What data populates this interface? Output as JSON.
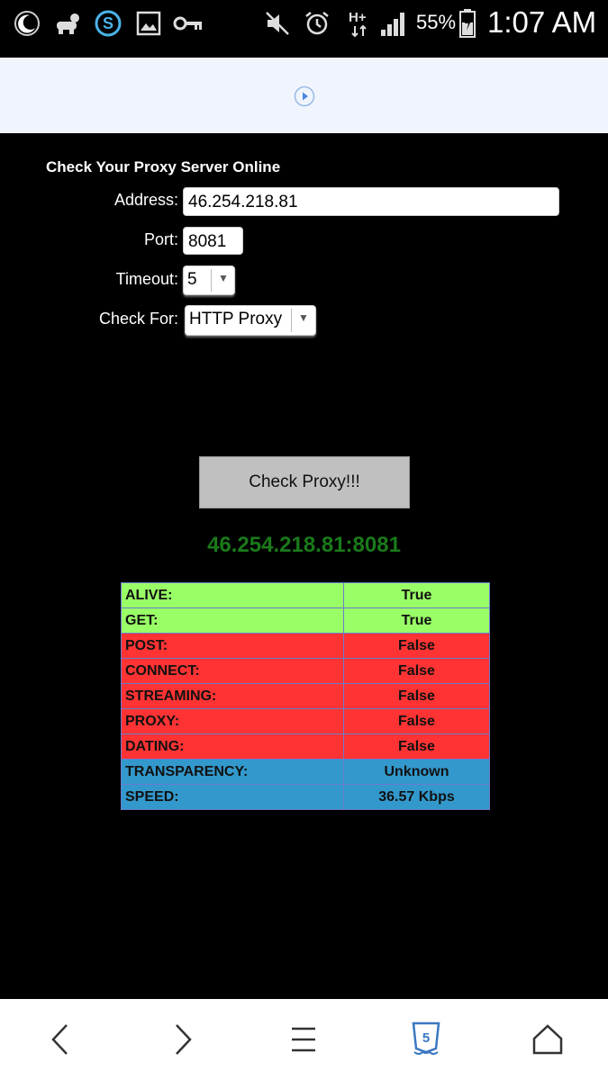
{
  "status_bar": {
    "icons": [
      "night-mode-icon",
      "baby-monitor-icon",
      "app-s-icon",
      "gallery-icon",
      "vpn-key-icon",
      "mute-icon",
      "alarm-icon",
      "hplus-data-icon",
      "signal-icon",
      "battery-icon"
    ],
    "battery_percent": "55%",
    "time": "1:07 AM"
  },
  "ad": {
    "icon": "ad-play-icon"
  },
  "form": {
    "heading": "Check Your Proxy Server Online",
    "address_label": "Address:",
    "address_value": "46.254.218.81",
    "port_label": "Port:",
    "port_value": "8081",
    "timeout_label": "Timeout:",
    "timeout_value": "5",
    "check_for_label": "Check For:",
    "check_for_value": "HTTP Proxy",
    "check_button": "Check Proxy!!!"
  },
  "result": {
    "title": "46.254.218.81:8081",
    "rows": [
      {
        "key": "ALIVE:",
        "value": "True",
        "color": "#99ff66"
      },
      {
        "key": "GET:",
        "value": "True",
        "color": "#99ff66"
      },
      {
        "key": "POST:",
        "value": "False",
        "color": "#ff3333"
      },
      {
        "key": "CONNECT:",
        "value": "False",
        "color": "#ff3333"
      },
      {
        "key": "STREAMING:",
        "value": "False",
        "color": "#ff3333"
      },
      {
        "key": "PROXY:",
        "value": "False",
        "color": "#ff3333"
      },
      {
        "key": "DATING:",
        "value": "False",
        "color": "#ff3333"
      },
      {
        "key": "TRANSPARENCY:",
        "value": "Unknown",
        "color": "#3399cc"
      },
      {
        "key": "SPEED:",
        "value": "36.57 Kbps",
        "color": "#3399cc"
      }
    ]
  },
  "nav": {
    "items": [
      "back-icon",
      "forward-icon",
      "menu-icon",
      "html5-tabs-icon",
      "home-icon"
    ],
    "tabs_count": "5"
  },
  "colors": {
    "true_bg": "#99ff66",
    "false_bg": "#ff3333",
    "info_bg": "#3399cc",
    "result_title": "#1a7a1a"
  }
}
